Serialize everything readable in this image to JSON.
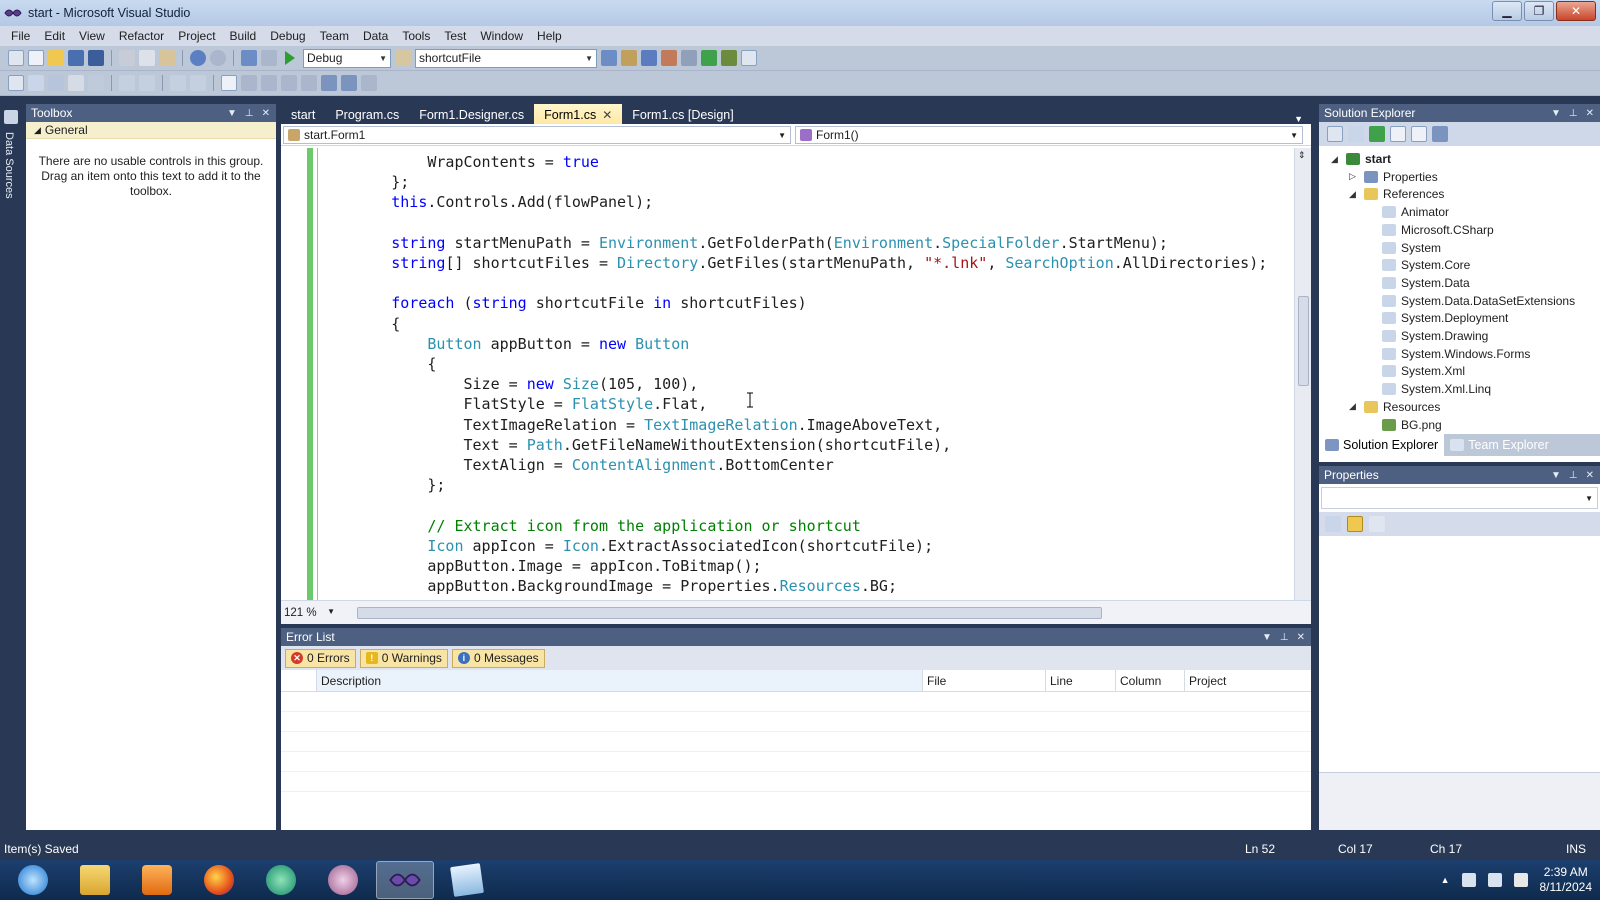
{
  "window": {
    "title": "start - Microsoft Visual Studio"
  },
  "menu": [
    "File",
    "Edit",
    "View",
    "Refactor",
    "Project",
    "Build",
    "Debug",
    "Team",
    "Data",
    "Tools",
    "Test",
    "Window",
    "Help"
  ],
  "toolbar": {
    "config": "Debug",
    "find": "shortcutFile"
  },
  "datasources": {
    "label": "Data Sources"
  },
  "toolbox": {
    "title": "Toolbox",
    "group": "General",
    "empty_message": "There are no usable controls in this group. Drag an item onto this text to add it to the toolbox."
  },
  "editor": {
    "tabs": [
      {
        "label": "start",
        "active": false
      },
      {
        "label": "Program.cs",
        "active": false
      },
      {
        "label": "Form1.Designer.cs",
        "active": false
      },
      {
        "label": "Form1.cs",
        "active": true
      },
      {
        "label": "Form1.cs [Design]",
        "active": false
      }
    ],
    "nav_class": "start.Form1",
    "nav_member": "Form1()",
    "zoom": "121 %",
    "code": [
      [
        [
          "",
          "            WrapContents = "
        ],
        [
          "kw",
          "true"
        ]
      ],
      [
        [
          "",
          "        };"
        ]
      ],
      [
        [
          "kw",
          "        this"
        ],
        [
          "",
          ".Controls.Add(flowPanel);"
        ]
      ],
      [
        [
          "",
          ""
        ]
      ],
      [
        [
          "kw",
          "        string"
        ],
        [
          "",
          " startMenuPath = "
        ],
        [
          "ty",
          "Environment"
        ],
        [
          "",
          ".GetFolderPath("
        ],
        [
          "ty",
          "Environment"
        ],
        [
          "",
          "."
        ],
        [
          "ty",
          "SpecialFolder"
        ],
        [
          "",
          ".StartMenu);"
        ]
      ],
      [
        [
          "kw",
          "        string"
        ],
        [
          "",
          "[] shortcutFiles = "
        ],
        [
          "ty",
          "Directory"
        ],
        [
          "",
          ".GetFiles(startMenuPath, "
        ],
        [
          "st",
          "\"*.lnk\""
        ],
        [
          "",
          ", "
        ],
        [
          "ty",
          "SearchOption"
        ],
        [
          "",
          ".AllDirectories);"
        ]
      ],
      [
        [
          "",
          ""
        ]
      ],
      [
        [
          "kw",
          "        foreach"
        ],
        [
          "",
          " ("
        ],
        [
          "kw",
          "string"
        ],
        [
          "",
          " shortcutFile "
        ],
        [
          "kw",
          "in"
        ],
        [
          "",
          " shortcutFiles)"
        ]
      ],
      [
        [
          "",
          "        {"
        ]
      ],
      [
        [
          "ty",
          "            Button"
        ],
        [
          "",
          " appButton = "
        ],
        [
          "kw",
          "new"
        ],
        [
          "",
          " "
        ],
        [
          "ty",
          "Button"
        ]
      ],
      [
        [
          "",
          "            {"
        ]
      ],
      [
        [
          "",
          "                Size = "
        ],
        [
          "kw",
          "new"
        ],
        [
          "",
          " "
        ],
        [
          "ty",
          "Size"
        ],
        [
          "",
          "(105, 100),"
        ]
      ],
      [
        [
          "",
          "                FlatStyle = "
        ],
        [
          "ty",
          "FlatStyle"
        ],
        [
          "",
          ".Flat,"
        ]
      ],
      [
        [
          "",
          "                TextImageRelation = "
        ],
        [
          "ty",
          "TextImageRelation"
        ],
        [
          "",
          ".ImageAboveText,"
        ]
      ],
      [
        [
          "",
          "                Text = "
        ],
        [
          "ty",
          "Path"
        ],
        [
          "",
          ".GetFileNameWithoutExtension(shortcutFile),"
        ]
      ],
      [
        [
          "",
          "                TextAlign = "
        ],
        [
          "ty",
          "ContentAlignment"
        ],
        [
          "",
          ".BottomCenter"
        ]
      ],
      [
        [
          "",
          "            };"
        ]
      ],
      [
        [
          "",
          ""
        ]
      ],
      [
        [
          "cm",
          "            // Extract icon from the application or shortcut"
        ]
      ],
      [
        [
          "ty",
          "            Icon"
        ],
        [
          "",
          " appIcon = "
        ],
        [
          "ty",
          "Icon"
        ],
        [
          "",
          ".ExtractAssociatedIcon(shortcutFile);"
        ]
      ],
      [
        [
          "",
          "            appButton.Image = appIcon.ToBitmap();"
        ]
      ],
      [
        [
          "",
          "            appButton.BackgroundImage = Properties."
        ],
        [
          "ty",
          "Resources"
        ],
        [
          "",
          ".BG;"
        ]
      ]
    ]
  },
  "errorlist": {
    "title": "Error List",
    "errors": "0 Errors",
    "warnings": "0 Warnings",
    "messages": "0 Messages",
    "columns": [
      "Description",
      "File",
      "Line",
      "Column",
      "Project"
    ]
  },
  "solution_explorer": {
    "title": "Solution Explorer",
    "tree": [
      {
        "label": "start",
        "level": 0,
        "twisty": "◢",
        "bold": true,
        "icon": "project-icon"
      },
      {
        "label": "Properties",
        "level": 1,
        "twisty": "▷",
        "icon": "properties-icon"
      },
      {
        "label": "References",
        "level": 1,
        "twisty": "◢",
        "icon": "folder-icon"
      },
      {
        "label": "Animator",
        "level": 2,
        "twisty": "",
        "icon": "reference-icon"
      },
      {
        "label": "Microsoft.CSharp",
        "level": 2,
        "twisty": "",
        "icon": "reference-icon"
      },
      {
        "label": "System",
        "level": 2,
        "twisty": "",
        "icon": "reference-icon"
      },
      {
        "label": "System.Core",
        "level": 2,
        "twisty": "",
        "icon": "reference-icon"
      },
      {
        "label": "System.Data",
        "level": 2,
        "twisty": "",
        "icon": "reference-icon"
      },
      {
        "label": "System.Data.DataSetExtensions",
        "level": 2,
        "twisty": "",
        "icon": "reference-icon"
      },
      {
        "label": "System.Deployment",
        "level": 2,
        "twisty": "",
        "icon": "reference-icon"
      },
      {
        "label": "System.Drawing",
        "level": 2,
        "twisty": "",
        "icon": "reference-icon"
      },
      {
        "label": "System.Windows.Forms",
        "level": 2,
        "twisty": "",
        "icon": "reference-icon"
      },
      {
        "label": "System.Xml",
        "level": 2,
        "twisty": "",
        "icon": "reference-icon"
      },
      {
        "label": "System.Xml.Linq",
        "level": 2,
        "twisty": "",
        "icon": "reference-icon"
      },
      {
        "label": "Resources",
        "level": 1,
        "twisty": "◢",
        "icon": "folder-icon"
      },
      {
        "label": "BG.png",
        "level": 2,
        "twisty": "",
        "icon": "image-icon"
      }
    ],
    "tabs": [
      "Solution Explorer",
      "Team Explorer"
    ]
  },
  "properties": {
    "title": "Properties"
  },
  "status": {
    "message": "Item(s) Saved",
    "ln": "Ln 52",
    "col": "Col 17",
    "ch": "Ch 17",
    "mode": "INS"
  },
  "taskbar": {
    "apps": [
      "internet-explorer",
      "file-explorer",
      "media-player",
      "firefox",
      "app-5",
      "app-6",
      "visual-studio",
      "notepad"
    ],
    "time": "2:39 AM",
    "date": "8/11/2024"
  },
  "colors": {
    "accent": "#293955",
    "active_tab": "#ffe8a6",
    "keyword": "#0000ff",
    "type": "#2b91af",
    "string": "#a31515",
    "comment": "#008000"
  }
}
